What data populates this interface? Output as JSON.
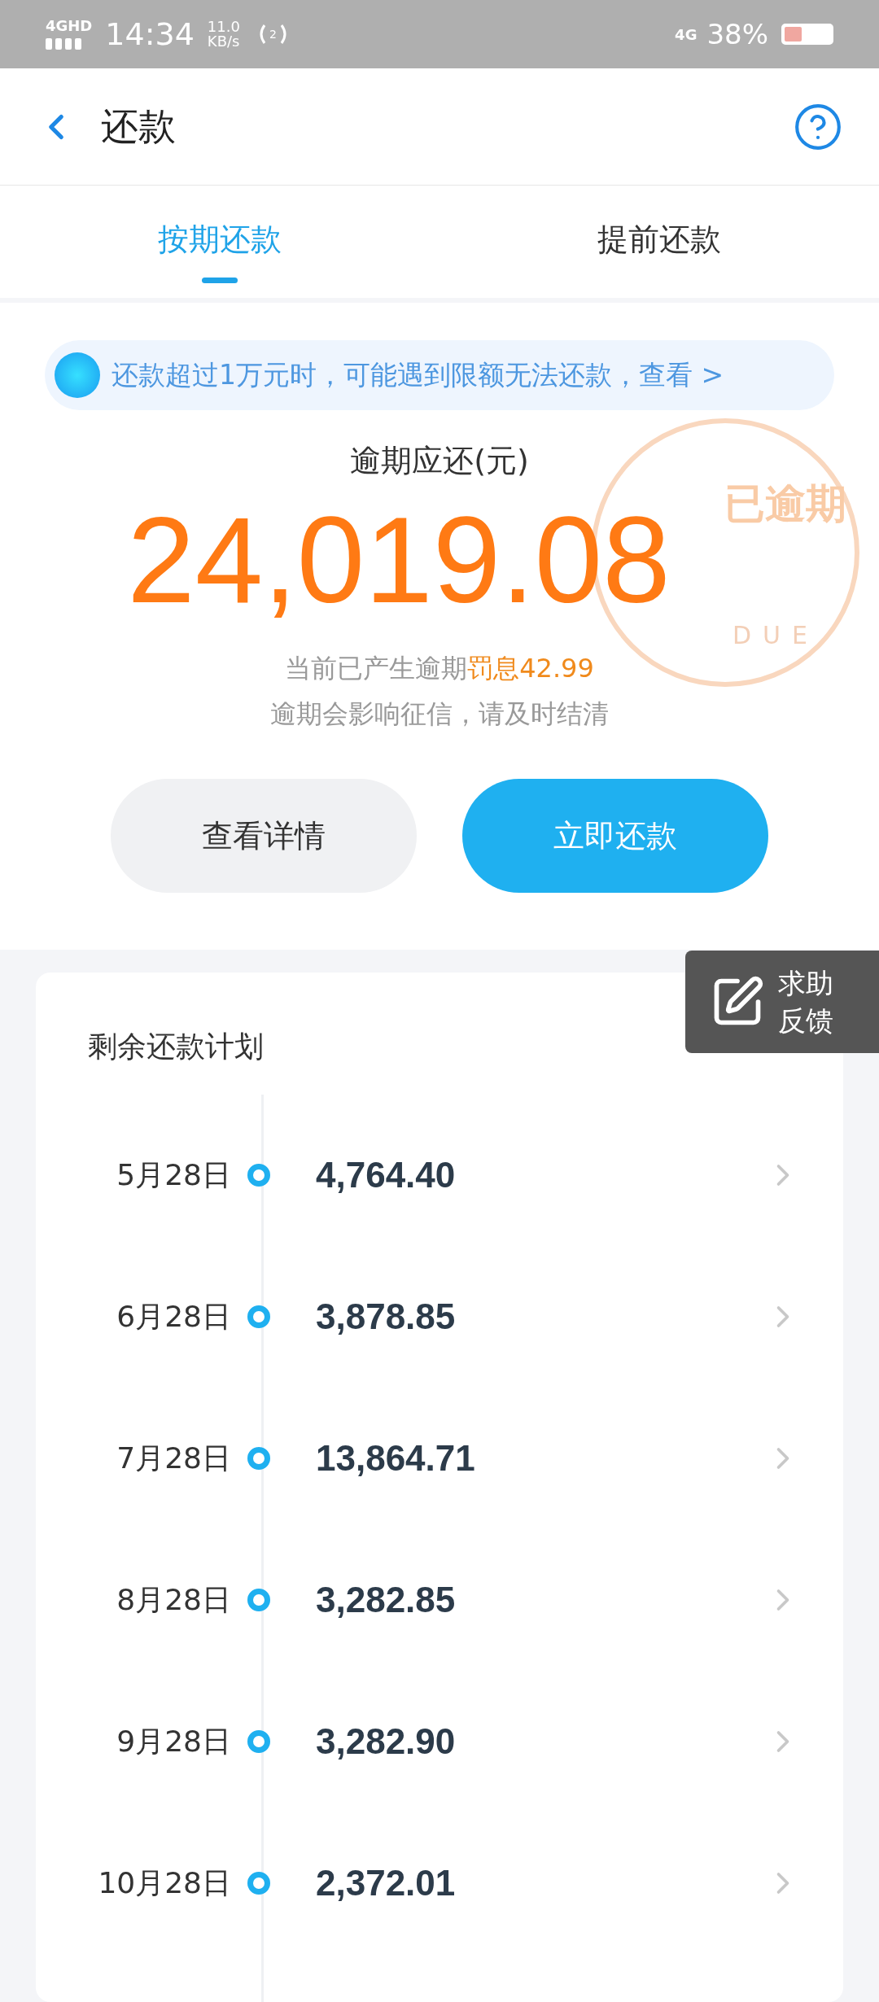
{
  "status_bar": {
    "network": "4GHD",
    "time": "14:34",
    "speed": "11.0",
    "speed_unit": "KB/s",
    "hotspot_count": "2",
    "mobile": "4G",
    "battery": "38%"
  },
  "header": {
    "title": "还款"
  },
  "tabs": [
    {
      "label": "按期还款",
      "selected": true
    },
    {
      "label": "提前还款",
      "selected": false
    }
  ],
  "notice": {
    "text": "还款超过1万元时，可能遇到限额无法还款，查看 >"
  },
  "overdue": {
    "label": "逾期应还(元)",
    "amount": "24,019.08",
    "stamp": "已逾期",
    "stamp_sub": "DUE",
    "penalty_prefix": "当前已产生逾期",
    "penalty": "罚息42.99",
    "warning": "逾期会影响征信，请及时结清"
  },
  "buttons": [
    {
      "label": "查看详情",
      "kind": "secondary"
    },
    {
      "label": "立即还款",
      "kind": "primary"
    }
  ],
  "feedback": {
    "line1": "求助",
    "line2": "反馈"
  },
  "plan": {
    "title": "剩余还款计划",
    "rows": [
      {
        "date": "5月28日",
        "amount": "4,764.40"
      },
      {
        "date": "6月28日",
        "amount": "3,878.85"
      },
      {
        "date": "7月28日",
        "amount": "13,864.71"
      },
      {
        "date": "8月28日",
        "amount": "3,282.85"
      },
      {
        "date": "9月28日",
        "amount": "3,282.90"
      },
      {
        "date": "10月28日",
        "amount": "2,372.01"
      }
    ]
  }
}
